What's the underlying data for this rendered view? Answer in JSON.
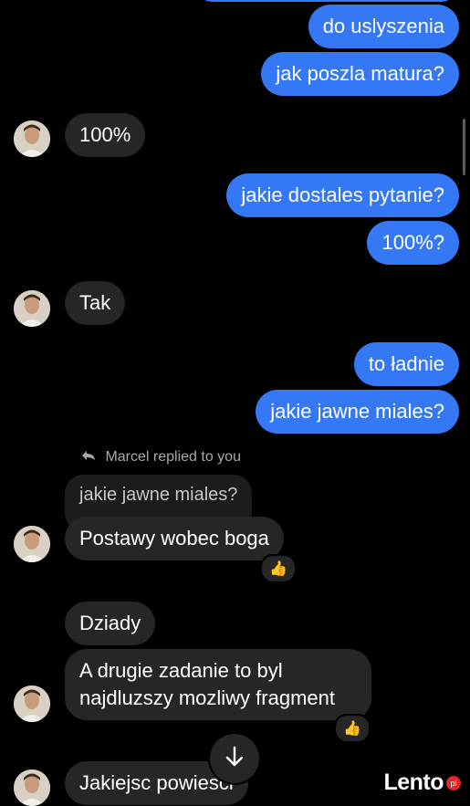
{
  "messages": {
    "out1": "do uslyszenia",
    "out2": "jak poszla matura?",
    "in1": "100%",
    "out3": "jakie dostales pytanie?",
    "out4": "100%?",
    "in2": "Tak",
    "out5": "to ładnie",
    "out6": "jakie jawne miales?",
    "reply_label": "Marcel replied to you",
    "quoted": "jakie jawne miales?",
    "in3": "Postawy wobec boga",
    "in4": "Dziady",
    "in5": "A drugie zadanie to byl najdluzszy mozliwy fragment",
    "in6": "Jakiejsc powiesci"
  },
  "reactions": {
    "r1": "👍",
    "r2": "👍"
  },
  "icons": {
    "reply": "reply-arrow-icon",
    "jump": "arrow-down-icon"
  },
  "colors": {
    "outgoing": "#3478f6",
    "incoming": "#262626",
    "background": "#000000"
  },
  "watermark": {
    "text": "Lento",
    "badge": "pl"
  }
}
